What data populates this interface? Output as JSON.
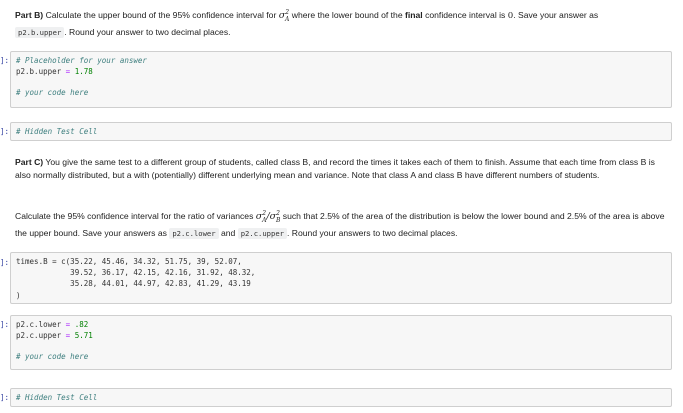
{
  "partB": {
    "lead": "Part B)",
    "text1": " Calculate the upper bound of the 95% confidence interval for ",
    "sigma_label": "σ",
    "sigma_sup": "2",
    "sigma_sub": "A",
    "text2": " where the lower bound of the ",
    "final_word": "final",
    "text3": " confidence interval is ",
    "zero": "0",
    "text4": ". Save your answer as",
    "code_var": "p2.b.upper",
    "text5": ". Round your answer to two decimal places."
  },
  "cell1": {
    "prompt": "]:",
    "line1": "# Placeholder for your answer",
    "line2_var": "p2.b.upper",
    "line2_op": " = ",
    "line2_val": "1.78",
    "line3": "# your code here"
  },
  "cell2": {
    "prompt": "]:",
    "line1": "# Hidden Test Cell"
  },
  "partC": {
    "lead": "Part C)",
    "para1": " You give the same test to a different group of students, called class B, and record the times it takes each of them to finish. Assume that each time from class B is also normally distributed, but a with (potentially) different underlying mean and variance. Note that class A and class B have different numbers of students.",
    "p2_text1": "Calculate the 95% confidence interval for the ratio of variances ",
    "ratio_num": "σ",
    "ratio_num_sup": "2",
    "ratio_num_sub": "A",
    "ratio_sep": "/",
    "ratio_den": "σ",
    "ratio_den_sup": "2",
    "ratio_den_sub": "B",
    "p2_text2": " such that 2.5% of the area of the distribution is below the lower bound and 2.5% of the area is above the upper bound. Save your answers as ",
    "code_lower": "p2.c.lower",
    "p2_and": " and ",
    "code_upper": "p2.c.upper",
    "p2_text3": ". Round your answers to two decimal places."
  },
  "cell3": {
    "prompt": "]:",
    "code_lines": [
      "times.B = c(35.22, 45.46, 34.32, 51.75, 39, 52.07,",
      "            39.52, 36.17, 42.15, 42.16, 31.92, 48.32,",
      "            35.28, 44.01, 44.97, 42.83, 41.29, 43.19",
      ")"
    ]
  },
  "cell4": {
    "prompt": "]:",
    "line1_var": "p2.c.lower",
    "line1_op": " = ",
    "line1_val": ".82",
    "line2_var": "p2.c.upper",
    "line2_op": " = ",
    "line2_val": "5.71",
    "line3": "# your code here"
  },
  "cell5": {
    "prompt": "]:",
    "line1": "# Hidden Test Cell"
  }
}
